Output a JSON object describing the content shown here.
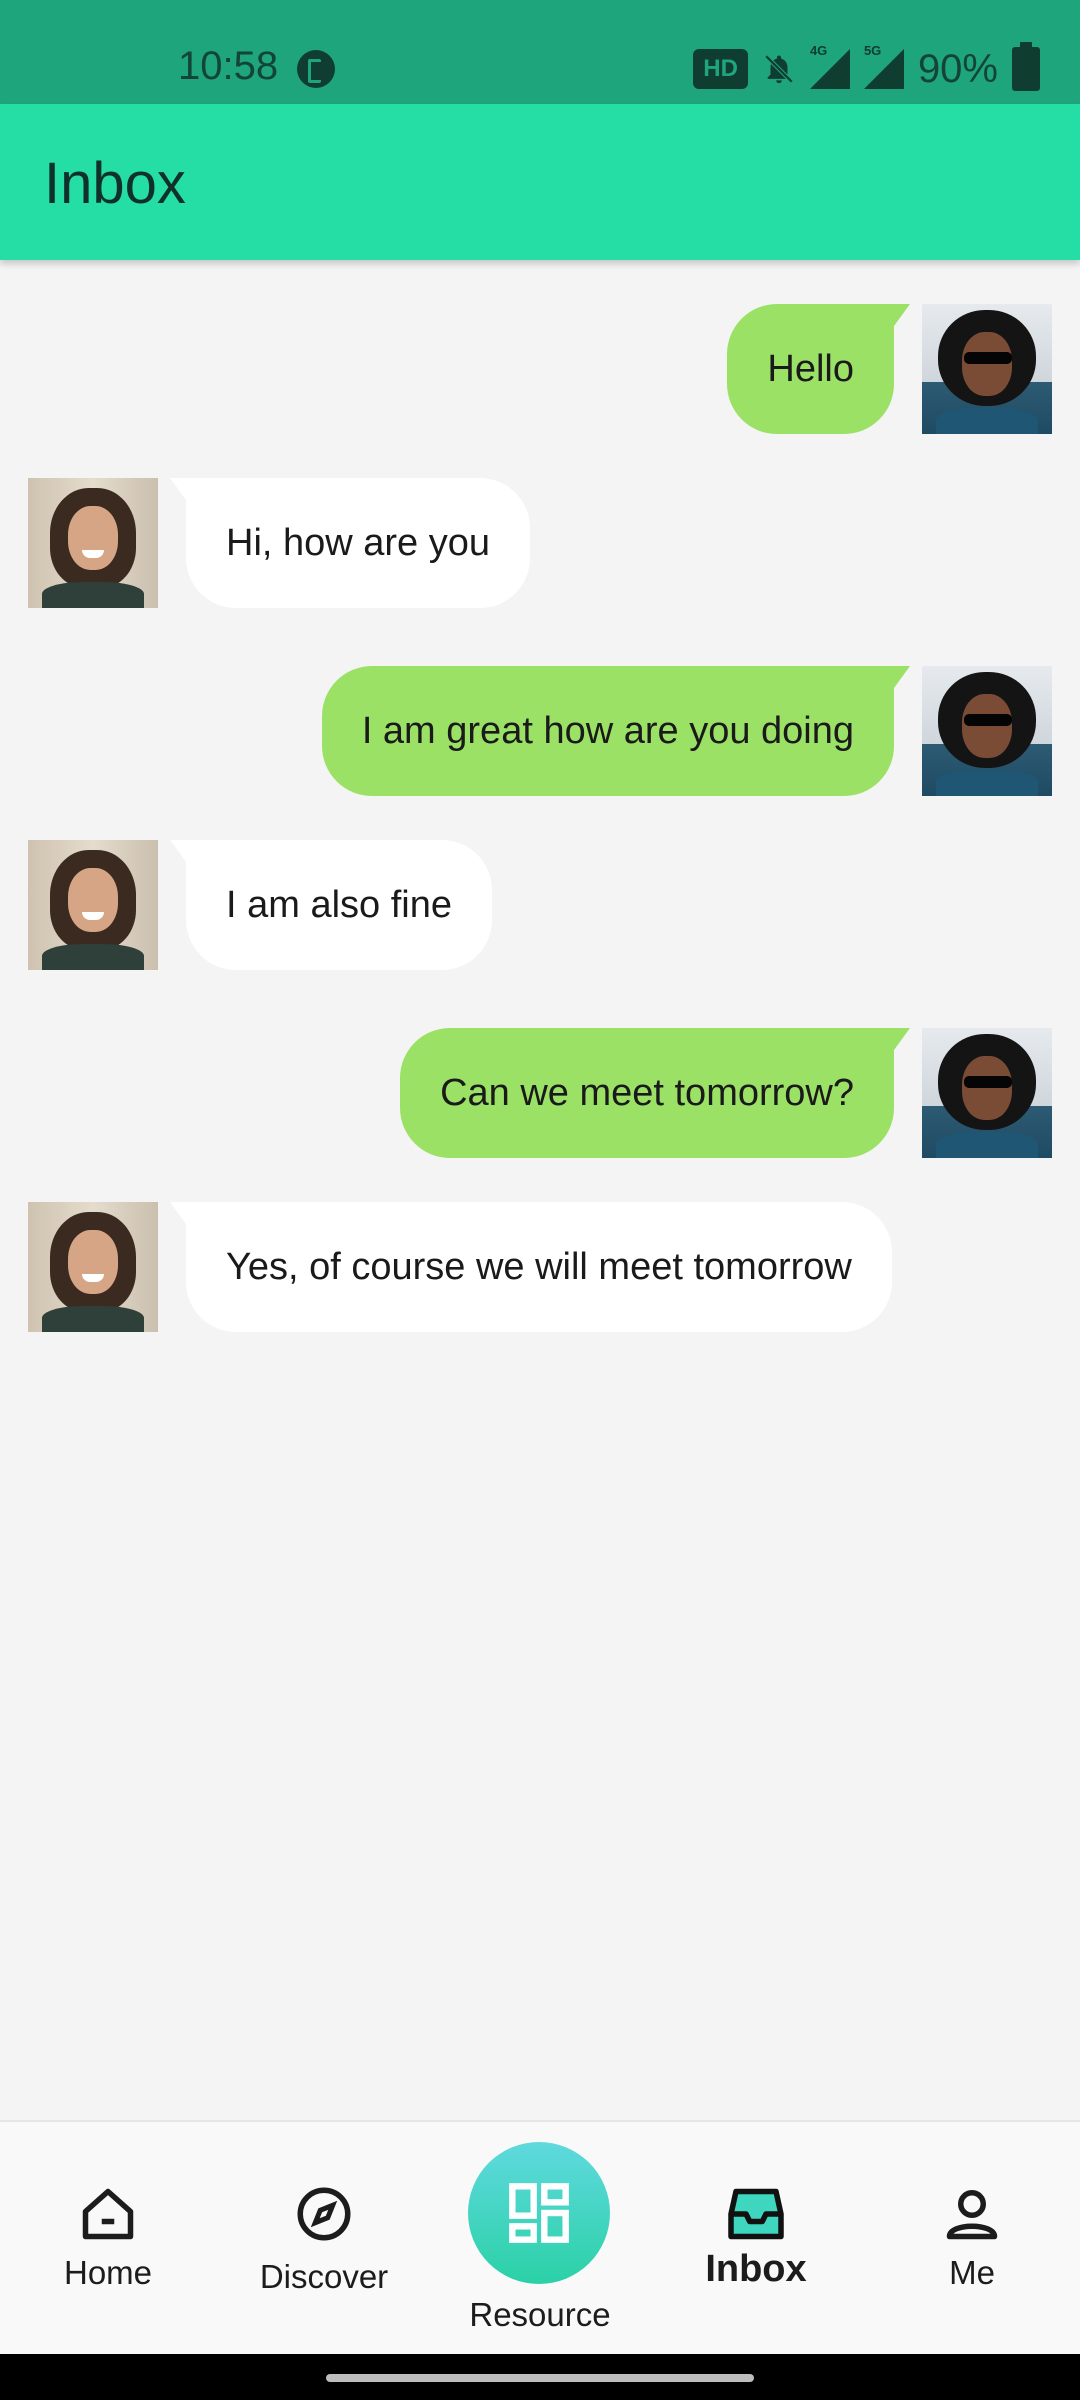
{
  "status_bar": {
    "time": "10:58",
    "hd_label": "HD",
    "network_4g": "4G",
    "network_5g": "5G",
    "battery": "90%"
  },
  "app_bar": {
    "title": "Inbox"
  },
  "messages": [
    {
      "from": "me",
      "text": "Hello"
    },
    {
      "from": "them",
      "text": "Hi, how are you"
    },
    {
      "from": "me",
      "text": "I am great how are you doing"
    },
    {
      "from": "them",
      "text": "I am also fine"
    },
    {
      "from": "me",
      "text": "Can we meet tomorrow?"
    },
    {
      "from": "them",
      "text": "Yes, of course we will meet tomorrow"
    }
  ],
  "bottom_nav": {
    "home": "Home",
    "discover": "Discover",
    "resource": "Resource",
    "inbox": "Inbox",
    "me": "Me",
    "active": "Inbox"
  },
  "colors": {
    "status_bar": "#1fa57c",
    "app_bar": "#24dea5",
    "my_bubble": "#9be166",
    "their_bubble": "#ffffff",
    "background": "#f4f4f4"
  }
}
